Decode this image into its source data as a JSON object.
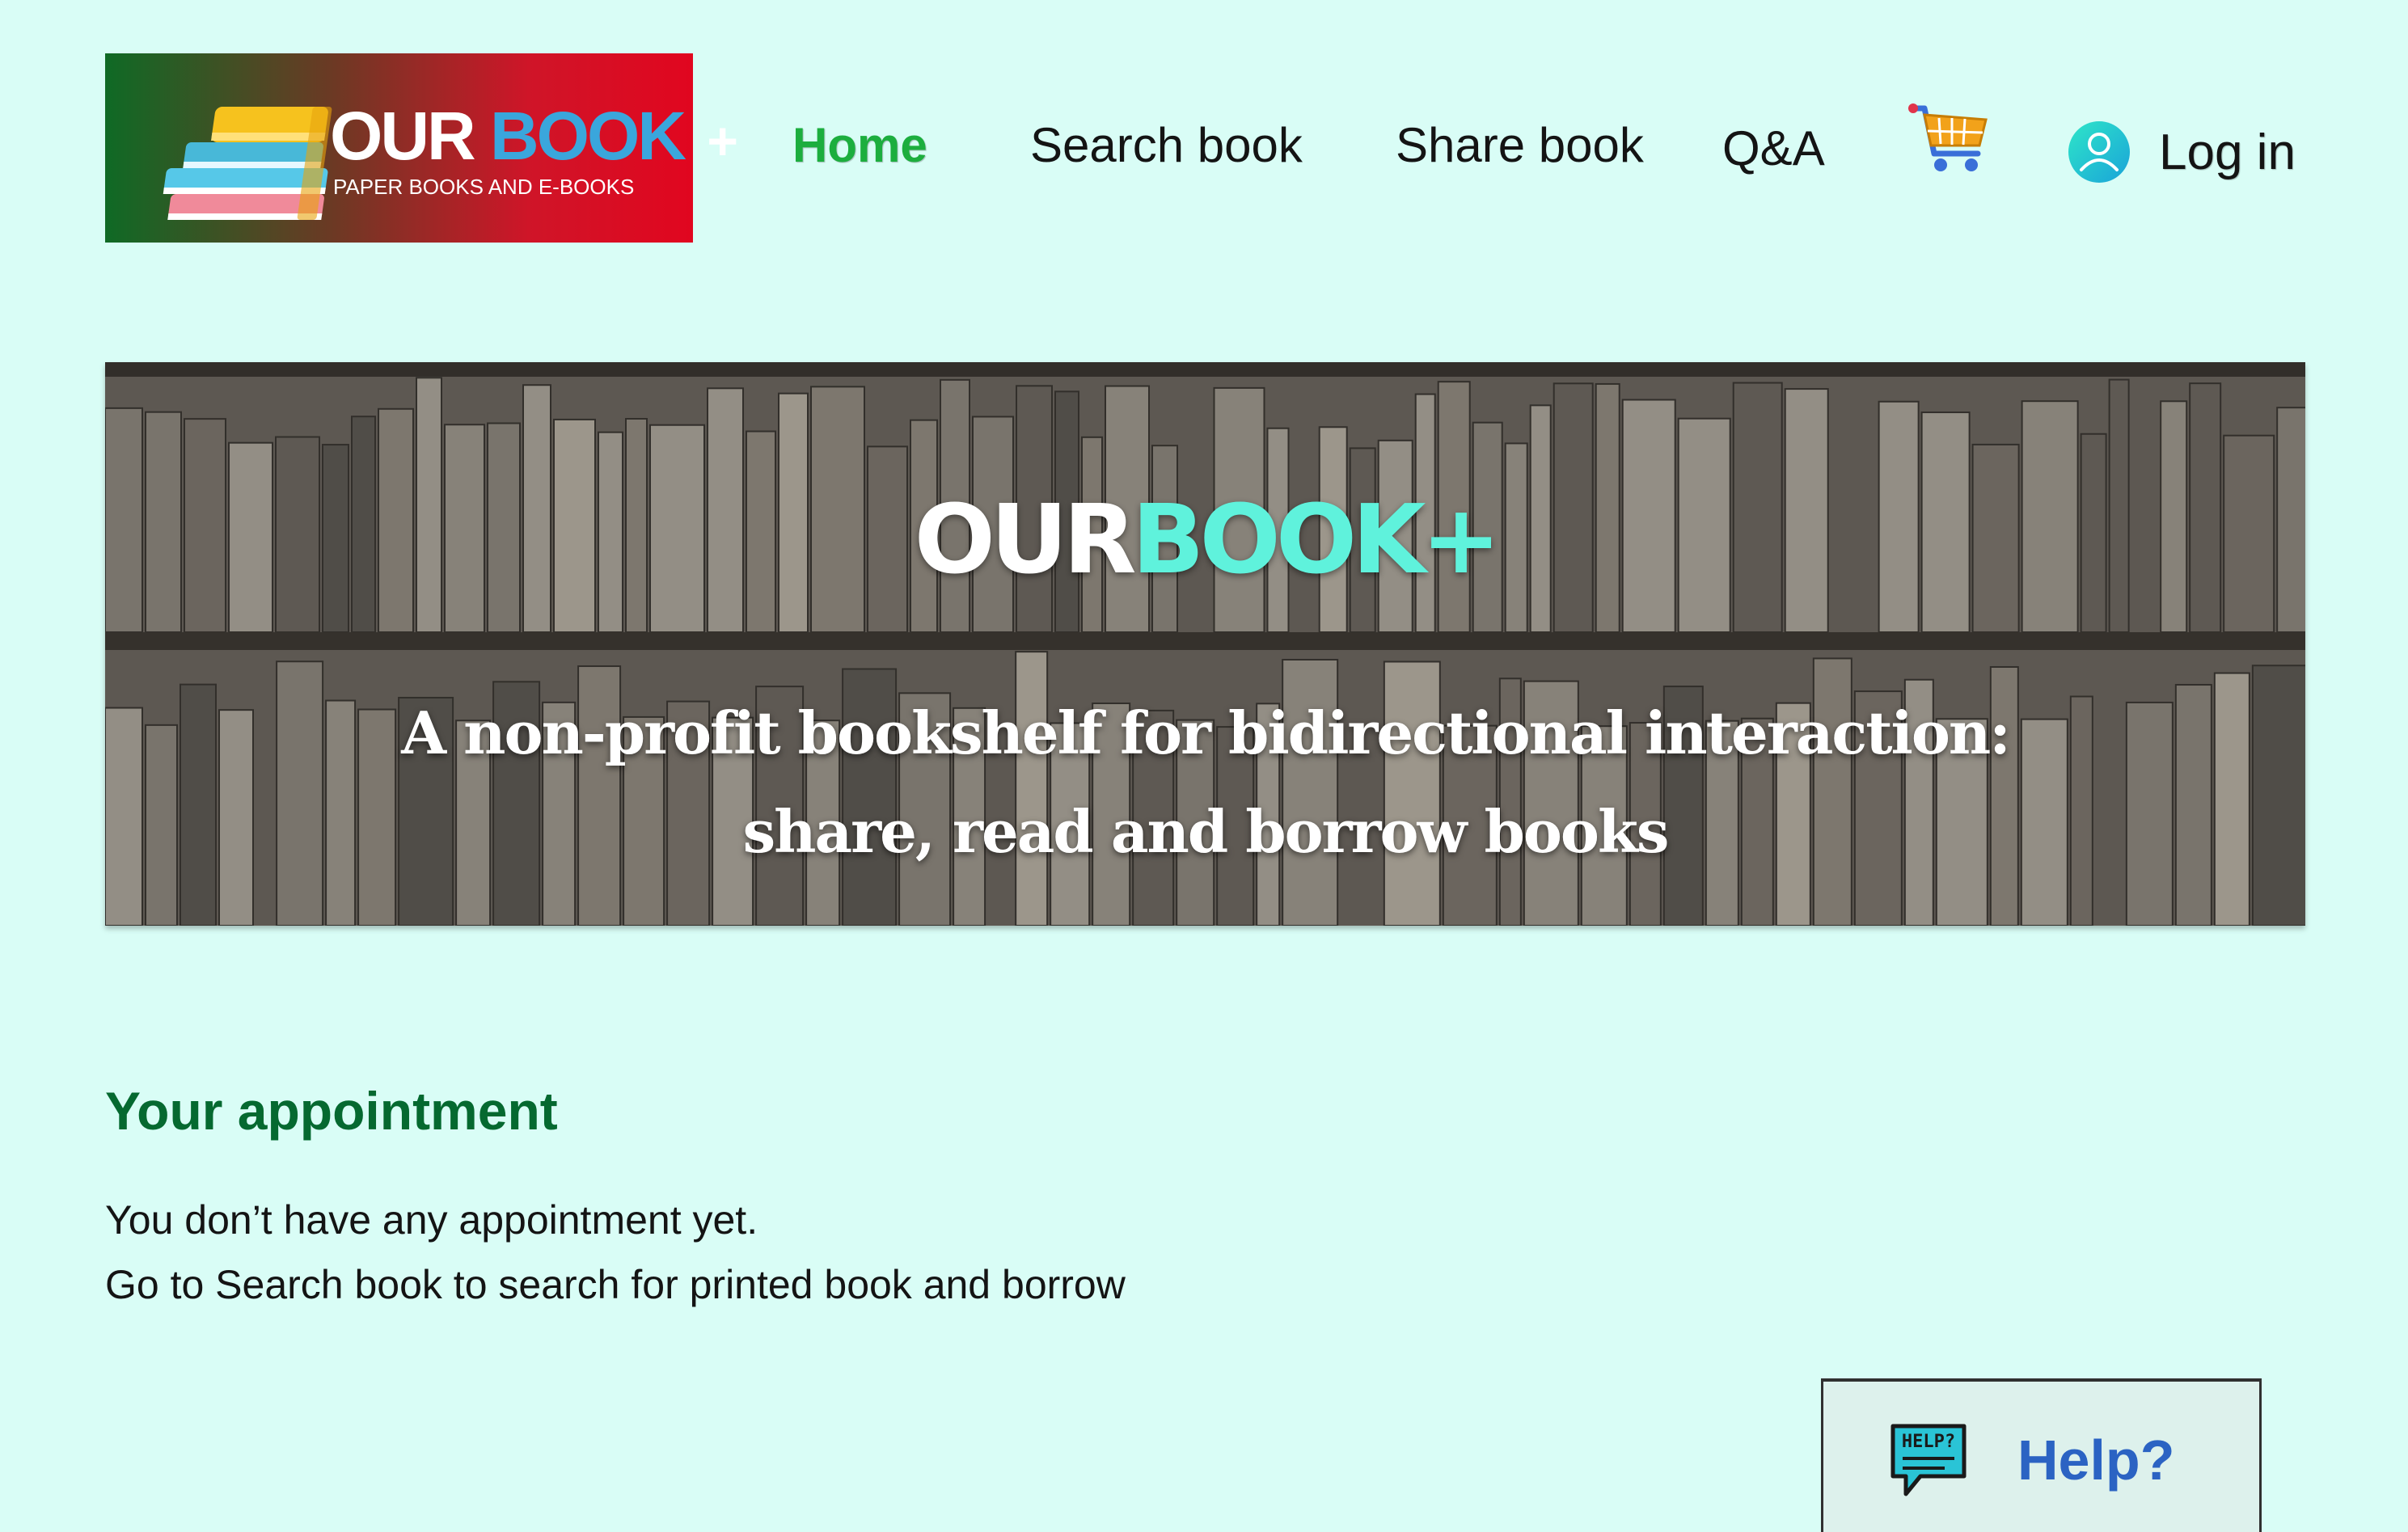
{
  "logo": {
    "title_part1": "OUR",
    "title_part2": "BOOK",
    "title_plus": "+",
    "subtitle": "PAPER BOOKS AND E-BOOKS"
  },
  "nav": {
    "home": "Home",
    "search": "Search book",
    "share": "Share book",
    "qa": "Q&A",
    "login": "Log in",
    "cart_icon": "shopping-cart",
    "user_icon": "user-circle"
  },
  "hero": {
    "title_part1": "OUR",
    "title_part2": "BOOK+",
    "tagline_line1": "A non-profit bookshelf for bidirectional interaction:",
    "tagline_line2": "share, read and borrow books"
  },
  "appointment": {
    "heading": "Your appointment",
    "line1": "You don’t have any appointment yet.",
    "line2": "Go to Search book to search for printed book and borrow"
  },
  "help": {
    "label": "Help?",
    "icon_text": "HELP?",
    "icon": "help-speech-bubble"
  },
  "colors": {
    "background": "#d9fdf6",
    "nav_active": "#1cae3e",
    "heading_green": "#056930",
    "help_blue": "#2b63c3",
    "hero_accent": "#5ff2dc"
  }
}
